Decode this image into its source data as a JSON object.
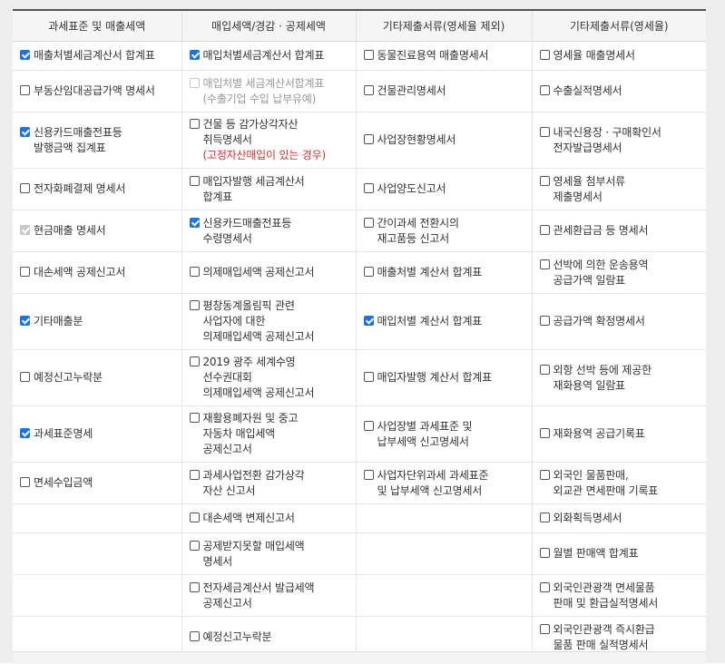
{
  "headers": [
    "과세표준 및 매출세액",
    "매입세액/경감 · 공제세액",
    "기타제출서류(영세율 제외)",
    "기타제출서류(영세율)"
  ],
  "rows": [
    [
      {
        "lines": [
          "매출처별세금계산서 합계표"
        ],
        "checked": true
      },
      {
        "lines": [
          "매입처별세금계산서 합계표"
        ],
        "checked": true
      },
      {
        "lines": [
          "동물진료용역 매출명세서"
        ],
        "checked": false
      },
      {
        "lines": [
          "영세율 매출명세서"
        ],
        "checked": false
      }
    ],
    [
      {
        "lines": [
          "부동산임대공급가액 명세서"
        ],
        "checked": false
      },
      {
        "lines": [
          "매입처별 세금계산서합계표",
          "(수출기업 수입 납부유예)"
        ],
        "checked": false,
        "disabled": true
      },
      {
        "lines": [
          "건물관리명세서"
        ],
        "checked": false
      },
      {
        "lines": [
          "수출실적명세서"
        ],
        "checked": false
      }
    ],
    [
      {
        "lines": [
          "신용카드매출전표등",
          "발행금액 집계표"
        ],
        "checked": true
      },
      {
        "lines": [
          "건물 등 감가상각자산",
          "취득명세서",
          "(고정자산매입이 있는 경우)"
        ],
        "checked": false,
        "red_line": 2
      },
      {
        "lines": [
          "사업장현황명세서"
        ],
        "checked": false
      },
      {
        "lines": [
          "내국신용장 · 구매확인서",
          "전자발급명세서"
        ],
        "checked": false
      }
    ],
    [
      {
        "lines": [
          "전자화폐결제 명세서"
        ],
        "checked": false
      },
      {
        "lines": [
          "매입자발행 세금계산서",
          "합계표"
        ],
        "checked": false
      },
      {
        "lines": [
          "사업양도신고서"
        ],
        "checked": false
      },
      {
        "lines": [
          "영세율 첨부서류",
          "제출명세서"
        ],
        "checked": false
      }
    ],
    [
      {
        "lines": [
          "현금매출 명세서"
        ],
        "checked": true,
        "disabled": true
      },
      {
        "lines": [
          "신용카드매출전표등",
          "수령명세서"
        ],
        "checked": true
      },
      {
        "lines": [
          "간이과세 전환시의",
          "재고품등 신고서"
        ],
        "checked": false
      },
      {
        "lines": [
          "관세환급금 등 명세서"
        ],
        "checked": false
      }
    ],
    [
      {
        "lines": [
          "대손세액 공제신고서"
        ],
        "checked": false
      },
      {
        "lines": [
          "의제매입세액 공제신고서"
        ],
        "checked": false
      },
      {
        "lines": [
          "매출처별 계산서 합계표"
        ],
        "checked": false
      },
      {
        "lines": [
          "선박에 의한 운송용역",
          "공급가액 일람표"
        ],
        "checked": false
      }
    ],
    [
      {
        "lines": [
          "기타매출분"
        ],
        "checked": true
      },
      {
        "lines": [
          "평창동계올림픽 관련",
          "사업자에 대한",
          "의제매입세액 공제신고서"
        ],
        "checked": false
      },
      {
        "lines": [
          "매입처별 계산서 합계표"
        ],
        "checked": true
      },
      {
        "lines": [
          "공급가액 확정명세서"
        ],
        "checked": false
      }
    ],
    [
      {
        "lines": [
          "예정신고누락분"
        ],
        "checked": false
      },
      {
        "lines": [
          "2019 광주 세계수영",
          "선수권대회",
          "의제매입세액 공제신고서"
        ],
        "checked": false
      },
      {
        "lines": [
          "매입자발행 계산서 합계표"
        ],
        "checked": false
      },
      {
        "lines": [
          "외항 선박 등에 제공한",
          "재화용역 일람표"
        ],
        "checked": false
      }
    ],
    [
      {
        "lines": [
          "과세표준명세"
        ],
        "checked": true
      },
      {
        "lines": [
          "재활용폐자원 및 중고",
          "자동차 매입세액",
          "공제신고서"
        ],
        "checked": false
      },
      {
        "lines": [
          "사업장별 과세표준 및",
          "납부세액 신고명세서"
        ],
        "checked": false
      },
      {
        "lines": [
          "재화용역 공급기록표"
        ],
        "checked": false
      }
    ],
    [
      {
        "lines": [
          "면세수입금액"
        ],
        "checked": false
      },
      {
        "lines": [
          "과세사업전환 감가상각",
          "자산 신고서"
        ],
        "checked": false
      },
      {
        "lines": [
          "사업자단위과세 과세표준",
          "및 납부세액 신고명세서"
        ],
        "checked": false
      },
      {
        "lines": [
          "외국인 물품판매,",
          "외교관 면세판매 기록표"
        ],
        "checked": false
      }
    ],
    [
      null,
      {
        "lines": [
          "대손세액 변제신고서"
        ],
        "checked": false
      },
      null,
      {
        "lines": [
          "외화획득명세서"
        ],
        "checked": false
      }
    ],
    [
      null,
      {
        "lines": [
          "공제받지못할 매입세액",
          "명세서"
        ],
        "checked": false
      },
      null,
      {
        "lines": [
          "월별 판매액 합계표"
        ],
        "checked": false
      }
    ],
    [
      null,
      {
        "lines": [
          "전자세금계산서 발급세액",
          "공제신고서"
        ],
        "checked": false
      },
      null,
      {
        "lines": [
          "외국인관광객 면세물품",
          "판매 및 환급실적명세서"
        ],
        "checked": false
      }
    ],
    [
      null,
      {
        "lines": [
          "예정신고누락분"
        ],
        "checked": false
      },
      null,
      {
        "lines": [
          "외국인관광객 즉시환급",
          "물품 판매 실적명세서"
        ],
        "checked": false
      }
    ]
  ]
}
